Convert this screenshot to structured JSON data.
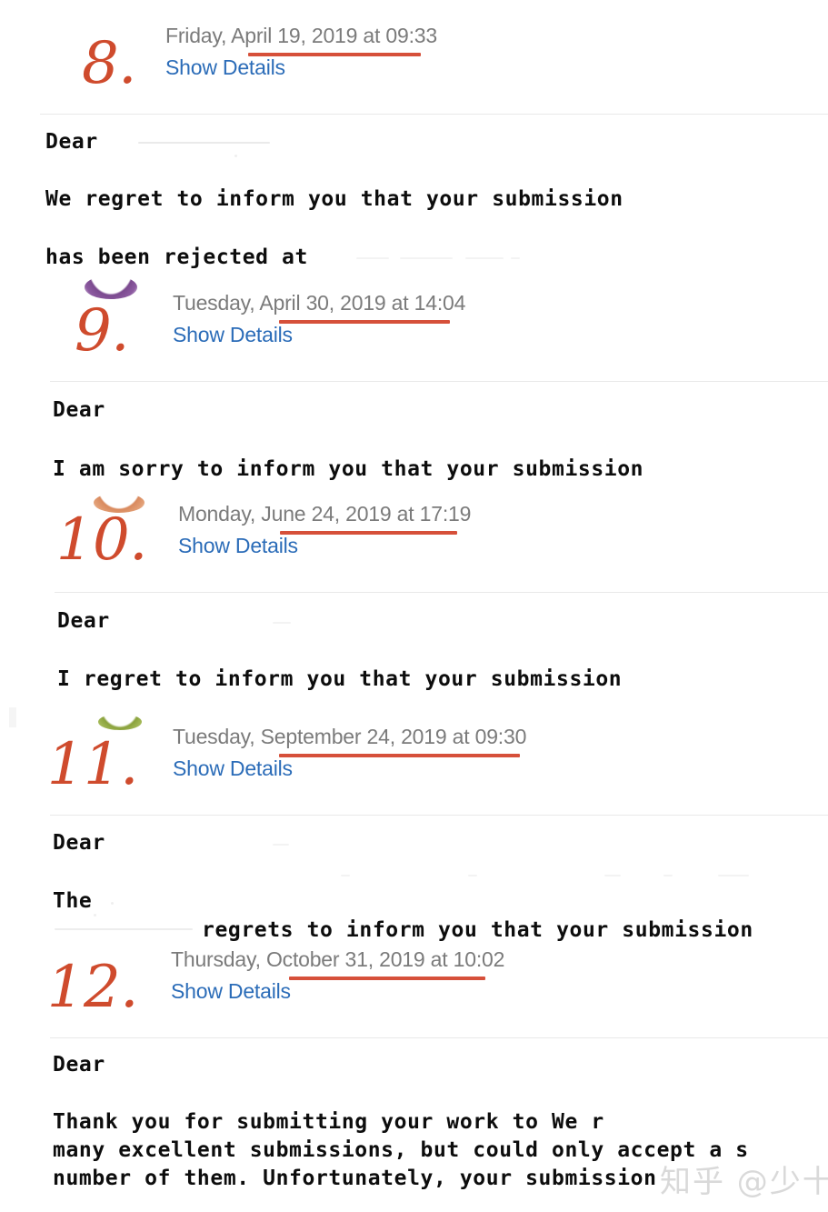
{
  "document": {
    "type": "email-thread-screenshot",
    "watermark": "知乎 @少十七"
  },
  "messages": [
    {
      "number": "8.",
      "date": "Friday, April 19, 2019 at 09:33",
      "show_details": "Show Details",
      "body": [
        "Dear",
        "We regret to inform you that your submission",
        "has been rejected at"
      ]
    },
    {
      "number": "9.",
      "date": "Tuesday, April 30, 2019 at 14:04",
      "show_details": "Show Details",
      "body": [
        "Dear",
        "I am sorry to inform you that your submission"
      ]
    },
    {
      "number": "10.",
      "date": "Monday, June 24, 2019 at 17:19",
      "show_details": "Show Details",
      "body": [
        "Dear",
        "I regret to inform you that your submission"
      ]
    },
    {
      "number": "11.",
      "date": "Tuesday, September 24, 2019 at 09:30",
      "show_details": "Show Details",
      "body": [
        "Dear",
        "The",
        "regrets to inform you that your submission"
      ]
    },
    {
      "number": "12.",
      "date": "Thursday, October 31, 2019 at 10:02",
      "show_details": "Show Details",
      "body": [
        "Dear",
        "Thank you for submitting your work to            We r",
        "many excellent submissions, but could only accept a s",
        "number of them. Unfortunately, your submission"
      ]
    }
  ],
  "colors": {
    "number_ink": "#cf4b2d",
    "date_text": "#7b7b7b",
    "link_text": "#2b6cb8",
    "underline": "#d6503a",
    "body_text": "#0d0d0d",
    "divider": "#e9e9e9",
    "watermark": "#d9d9d9",
    "crescent_purple": "#7b4a8f",
    "crescent_green": "#8aa23c",
    "crescent_orange": "#d98a5e"
  }
}
